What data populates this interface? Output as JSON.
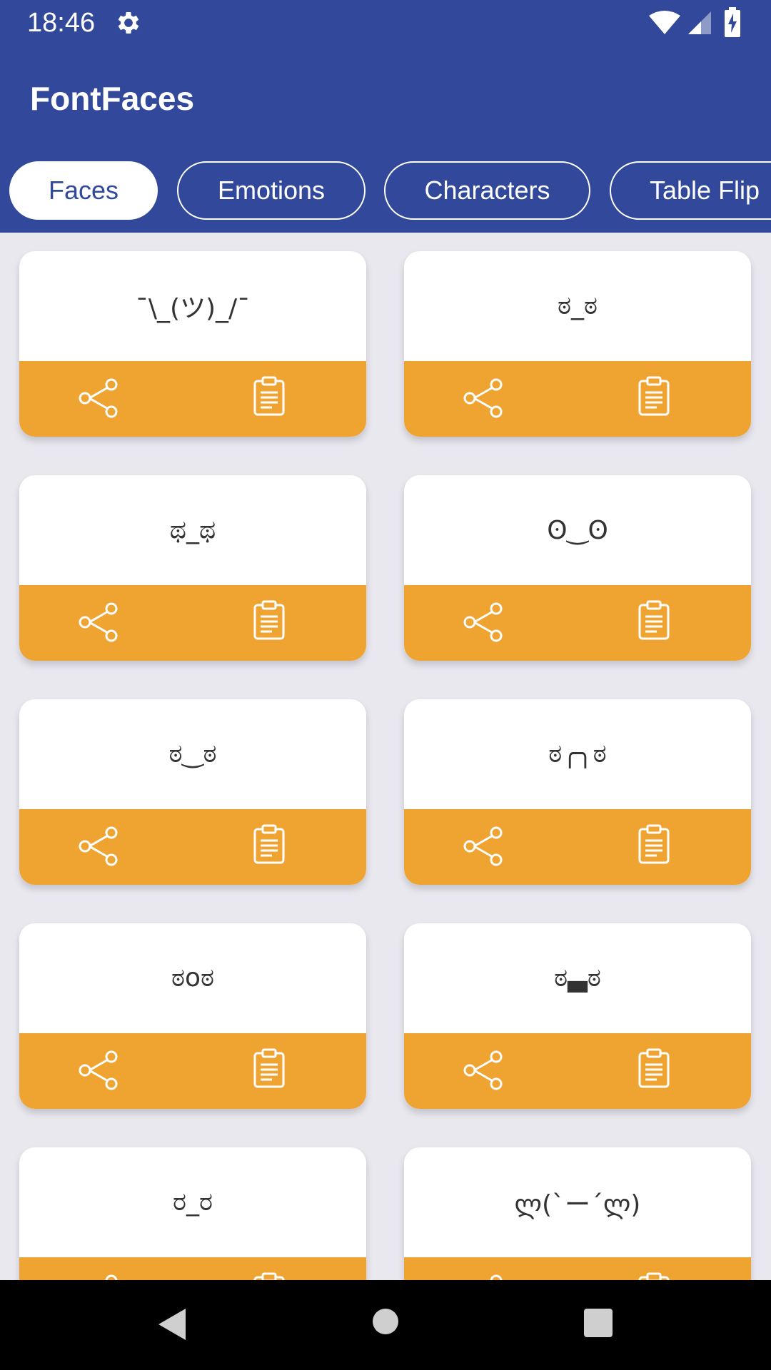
{
  "status_bar": {
    "time": "18:46"
  },
  "app": {
    "title": "FontFaces"
  },
  "tabs": [
    {
      "label": "Faces",
      "active": true
    },
    {
      "label": "Emotions",
      "active": false
    },
    {
      "label": "Characters",
      "active": false
    },
    {
      "label": "Table Flip",
      "active": false
    }
  ],
  "faces": [
    "¯\\_(ツ)_/¯",
    "ಠ_ಠ",
    "ಥ_ಥ",
    "ʘ‿ʘ",
    "ಠ‿ಠ",
    "ಠ╭╮ಠ",
    "ಠoಠ",
    "ಠ▃ಠ",
    "ರ_ರ",
    "ლ(`ー´ლ)"
  ],
  "colors": {
    "header": "#32499b",
    "accent": "#efa331",
    "background": "#e9e8ef",
    "nav_bar": "#000000"
  },
  "icons": {
    "status": [
      "gear-icon",
      "wifi-icon",
      "signal-icon",
      "battery-icon"
    ],
    "card_actions": [
      "share-icon",
      "clipboard-icon"
    ],
    "nav": [
      "back-icon",
      "home-icon",
      "recents-icon"
    ]
  }
}
